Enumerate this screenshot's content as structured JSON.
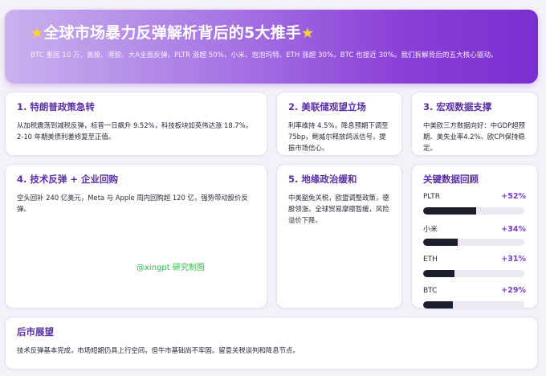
{
  "header": {
    "star_icon": "star-emoji",
    "title": "全球市场暴力反弹解析背后的5大推手",
    "subtitle": "BTC 重回 10 万，美股、港股、大A全面反弹，PLTR 涨超 50%，小米、泡泡玛特、ETH 涨超 30%，BTC 也接近 30%。我们拆解背后的五大核心驱动。"
  },
  "cards": [
    {
      "title": "1. 特朗普政策急转",
      "text": "从加税震荡到减税反弹，标普一日飙升 9.52%，科技板块如英伟达涨 18.7%，2-10 年期美债利差修复至正值。"
    },
    {
      "title": "2. 美联储观望立场",
      "text": "利率维持 4.5%，降息预期下调至 75bp，鲍威尔释放鸽派信号，提振市场信心。"
    },
    {
      "title": "3. 宏观数据支撑",
      "text": "中美欧三方数据向好：中GDP超预期、美失业率4.2%、欧CPI保持稳定。"
    },
    {
      "title": "4. 技术反弹 + 企业回购",
      "text": "空头回补 240 亿美元，Meta 与 Apple 周内回购超 120 亿，强势带动股价反弹。"
    },
    {
      "title": "5. 地缘政治缓和",
      "text": "中美豁免关税，欧盟调整政策，德股领涨。全球贸易摩擦暂缓，风险溢价下降。"
    }
  ],
  "watermark": "@xingpt 研究制图",
  "metrics_panel": {
    "title": "关键数据回顾",
    "items": [
      {
        "label": "PLTR",
        "value": "+52%",
        "fill": 0.52
      },
      {
        "label": "小米",
        "value": "+34%",
        "fill": 0.34
      },
      {
        "label": "ETH",
        "value": "+31%",
        "fill": 0.31
      },
      {
        "label": "BTC",
        "value": "+29%",
        "fill": 0.29
      }
    ],
    "bar_color": "#1b1e2c",
    "value_color": "#7c3cc8"
  },
  "outlook": {
    "title": "后市展望",
    "text": "技术反弹基本完成，市场短期仍具上行空间，但牛市基础尚不牢固。留意关税谈判和降息节点。"
  },
  "colors": {
    "accent": "#5b2ea6",
    "header_gradient_start": "#c9b2ee",
    "header_gradient_end": "#7a2fd0"
  }
}
